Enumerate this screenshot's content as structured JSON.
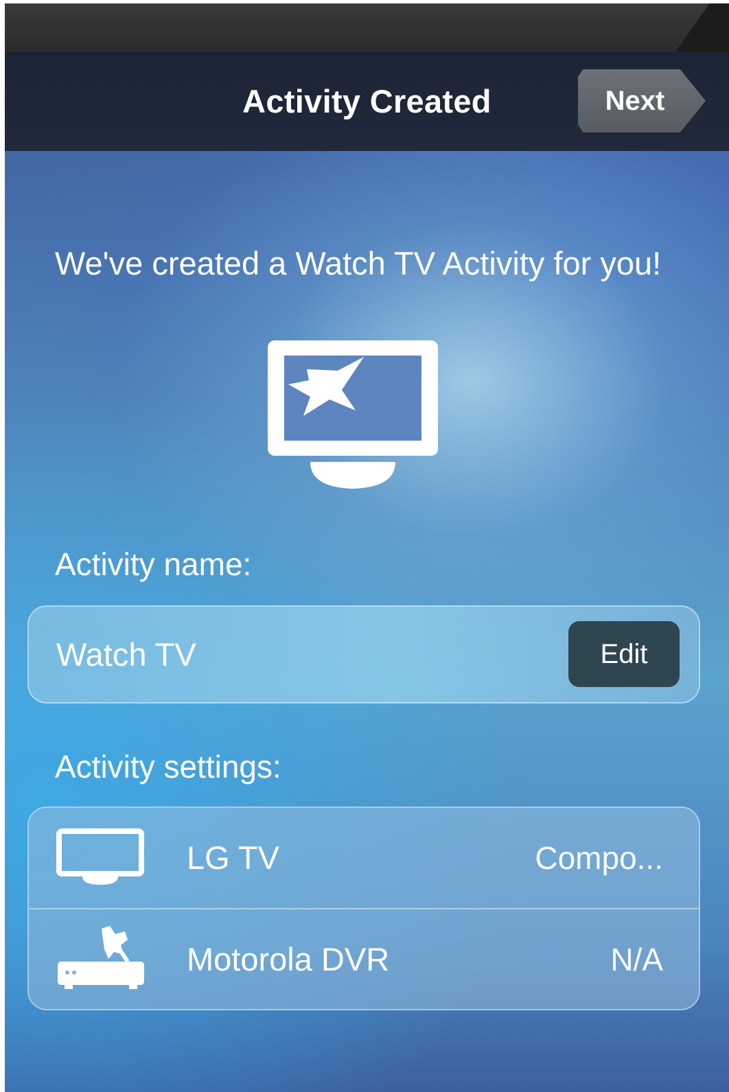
{
  "header": {
    "title": "Activity Created",
    "next_label": "Next"
  },
  "intro_text": "We've created a Watch TV Activity for you!",
  "hero": {
    "icon": "tv-star-icon"
  },
  "activity_name": {
    "label": "Activity name:",
    "value": "Watch TV",
    "edit_label": "Edit"
  },
  "activity_settings": {
    "label": "Activity settings:",
    "rows": [
      {
        "icon": "tv-icon",
        "name": "LG TV",
        "value": "Compo..."
      },
      {
        "icon": "dvr-satellite-icon",
        "name": "Motorola DVR",
        "value": "N/A"
      }
    ]
  },
  "colors": {
    "navbar": "#1c2434",
    "next_button": "#62676d",
    "edit_button": "#2f4650",
    "text": "#ffffff"
  }
}
